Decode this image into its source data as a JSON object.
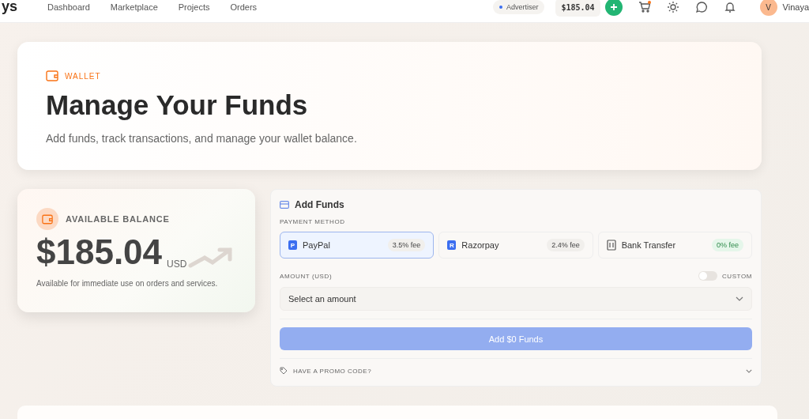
{
  "header": {
    "logo": "ys",
    "nav": [
      {
        "label": "Dashboard"
      },
      {
        "label": "Marketplace"
      },
      {
        "label": "Projects"
      },
      {
        "label": "Orders"
      }
    ],
    "role": "Advertiser",
    "balance": "$185.04",
    "avatar": "V",
    "user": "Vinaya"
  },
  "hero": {
    "eyebrow": "WALLET",
    "title": "Manage Your Funds",
    "subtitle": "Add funds, track transactions, and manage your wallet balance."
  },
  "balance_card": {
    "label": "AVAILABLE BALANCE",
    "amount": "$185.04",
    "currency": "USD",
    "note": "Available for immediate use on orders and services."
  },
  "add_funds": {
    "title": "Add Funds",
    "method_label": "PAYMENT METHOD",
    "methods": [
      {
        "kind": "letter",
        "badge": "P",
        "name": "PayPal",
        "fee": "3.5% fee",
        "free": false,
        "selected": true
      },
      {
        "kind": "letter",
        "badge": "R",
        "name": "Razorpay",
        "fee": "2.4% fee",
        "free": false,
        "selected": false
      },
      {
        "kind": "bank",
        "name": "Bank Transfer",
        "fee": "0% fee",
        "free": true,
        "selected": false
      }
    ],
    "amount_label": "AMOUNT (USD)",
    "custom_label": "CUSTOM",
    "custom_on": false,
    "amount_placeholder": "Select an amount",
    "button": "Add $0 Funds",
    "button_disabled": true,
    "promo": "HAVE A PROMO CODE?"
  }
}
